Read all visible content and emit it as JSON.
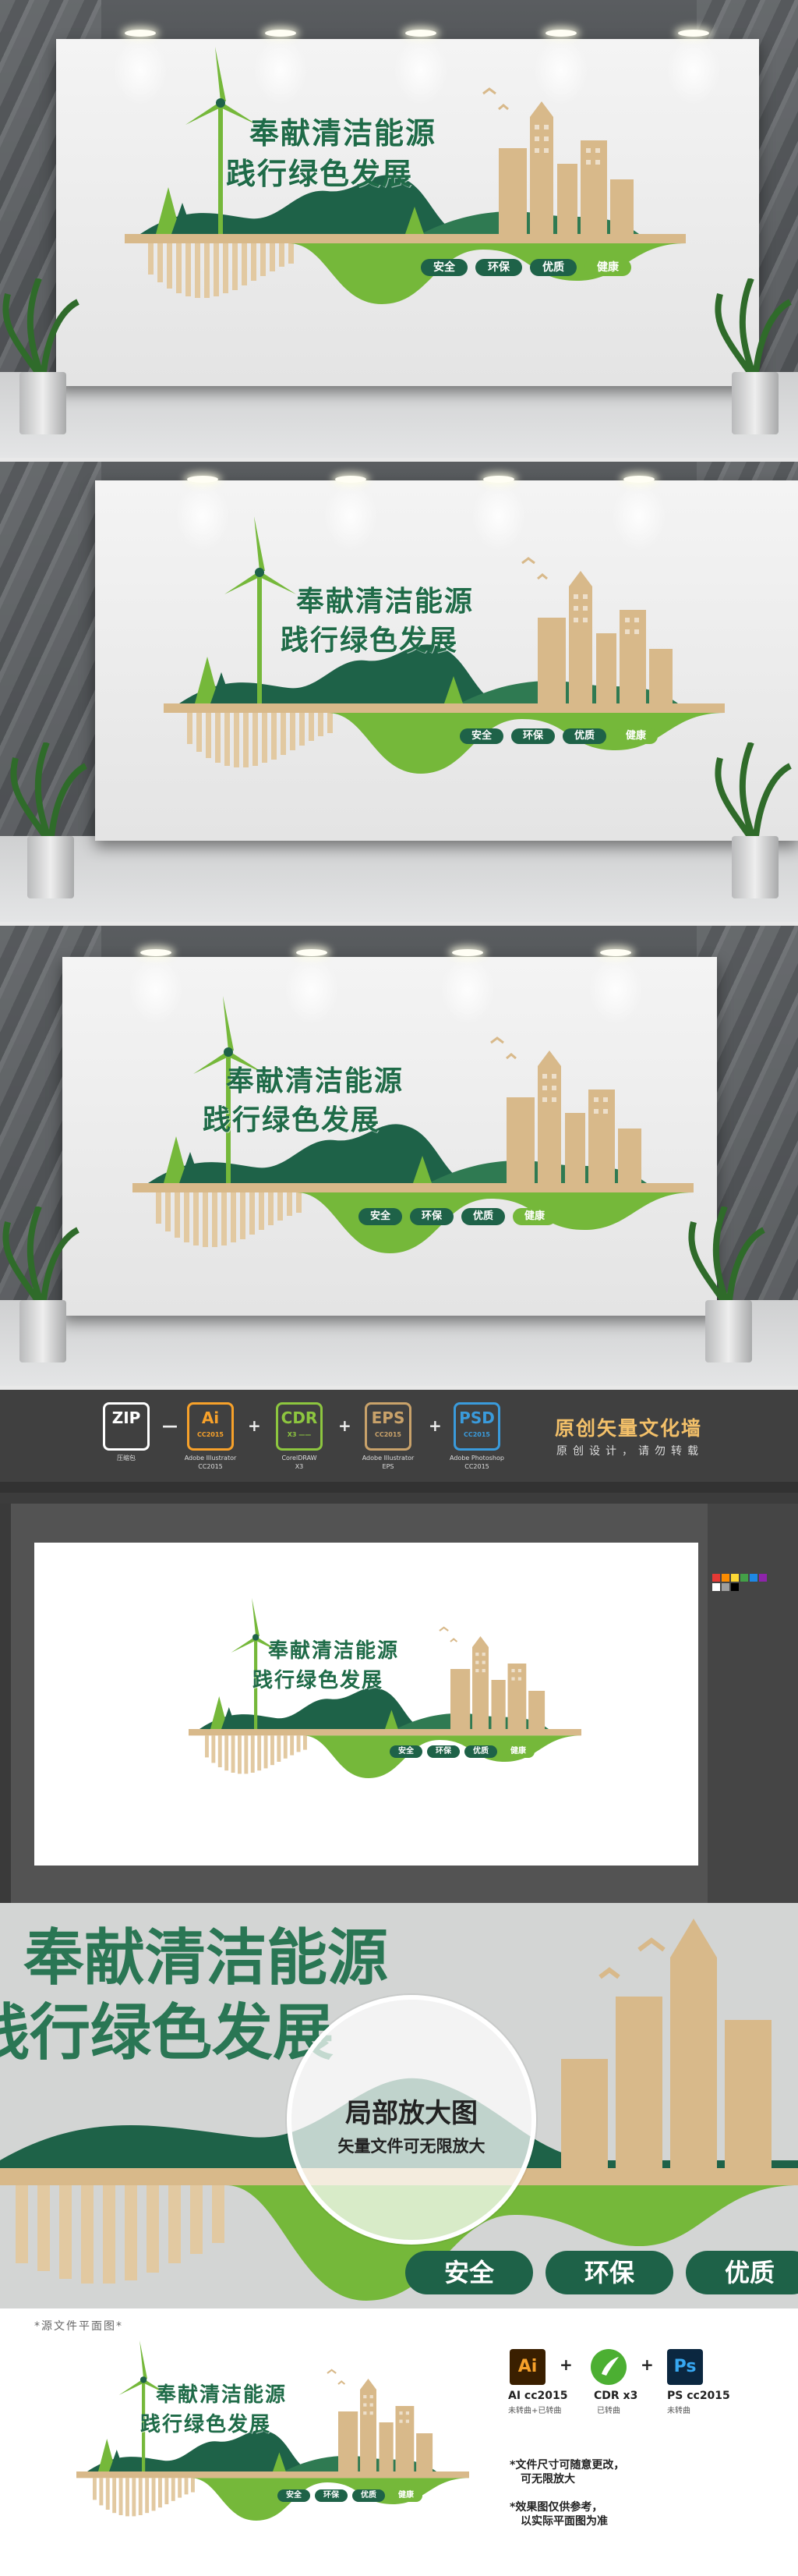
{
  "sign": {
    "title_line1": "奉献清洁能源",
    "title_line2": "践行绿色发展",
    "pills": [
      "安全",
      "环保",
      "优质",
      "健康"
    ],
    "colors": {
      "dark_green": "#1e6248",
      "light_green": "#75b83a",
      "tan": "#d8b98a",
      "title": "#1f6b48"
    }
  },
  "software_bar": {
    "badges": [
      {
        "big": "ZIP",
        "ver": "",
        "caption1": "压缩包",
        "caption2": "",
        "icon": "zip-icon",
        "color": "#ffffff"
      },
      {
        "big": "Ai",
        "ver": "CC2015",
        "caption1": "Adobe Illustrator",
        "caption2": "CC2015",
        "icon": "illustrator-icon",
        "color": "#f7a12a"
      },
      {
        "big": "CDR",
        "ver": "X3 ——",
        "caption1": "CorelDRAW",
        "caption2": "X3",
        "icon": "coreldraw-icon",
        "color": "#8dc63f"
      },
      {
        "big": "EPS",
        "ver": "CC2015",
        "caption1": "Adobe Illustrator",
        "caption2": "EPS",
        "icon": "eps-icon",
        "color": "#c9a26a"
      },
      {
        "big": "PSD",
        "ver": "CC2015",
        "caption1": "Adobe Photoshop",
        "caption2": "CC2015",
        "icon": "photoshop-icon",
        "color": "#3a9bdc"
      }
    ],
    "separators": [
      "—",
      "+",
      "+",
      "+"
    ],
    "title": "原创矢量文化墙",
    "subtitle": "原创设计，请勿转载"
  },
  "zoom_panel": {
    "title_line1": "奉献清洁能源",
    "title_line2": "践行绿色发展",
    "heading": "局部放大图",
    "subheading": "矢量文件可无限放大",
    "pills": [
      "安全",
      "环保",
      "优质"
    ]
  },
  "flat_panel": {
    "caption": "*源文件平面图*",
    "software": [
      {
        "icon_text": "Ai",
        "label": "AI cc2015",
        "sub": "未转曲+已转曲",
        "icon": "illustrator-icon",
        "bg": "#3a1f00",
        "fg": "#f7a12a"
      },
      {
        "icon_text": "",
        "label": "CDR x3",
        "sub": "已转曲",
        "icon": "coreldraw-icon",
        "bg": "#4caf32",
        "fg": "#ffffff"
      },
      {
        "icon_text": "Ps",
        "label": "PS cc2015",
        "sub": "未转曲",
        "icon": "photoshop-icon",
        "bg": "#0b2740",
        "fg": "#37a8f2"
      }
    ],
    "plus": "+",
    "note1_a": "*文件尺寸可随意更改，",
    "note1_b": "可无限放大",
    "note2_a": "*效果图仅供参考，",
    "note2_b": "以实际平面图为准"
  }
}
